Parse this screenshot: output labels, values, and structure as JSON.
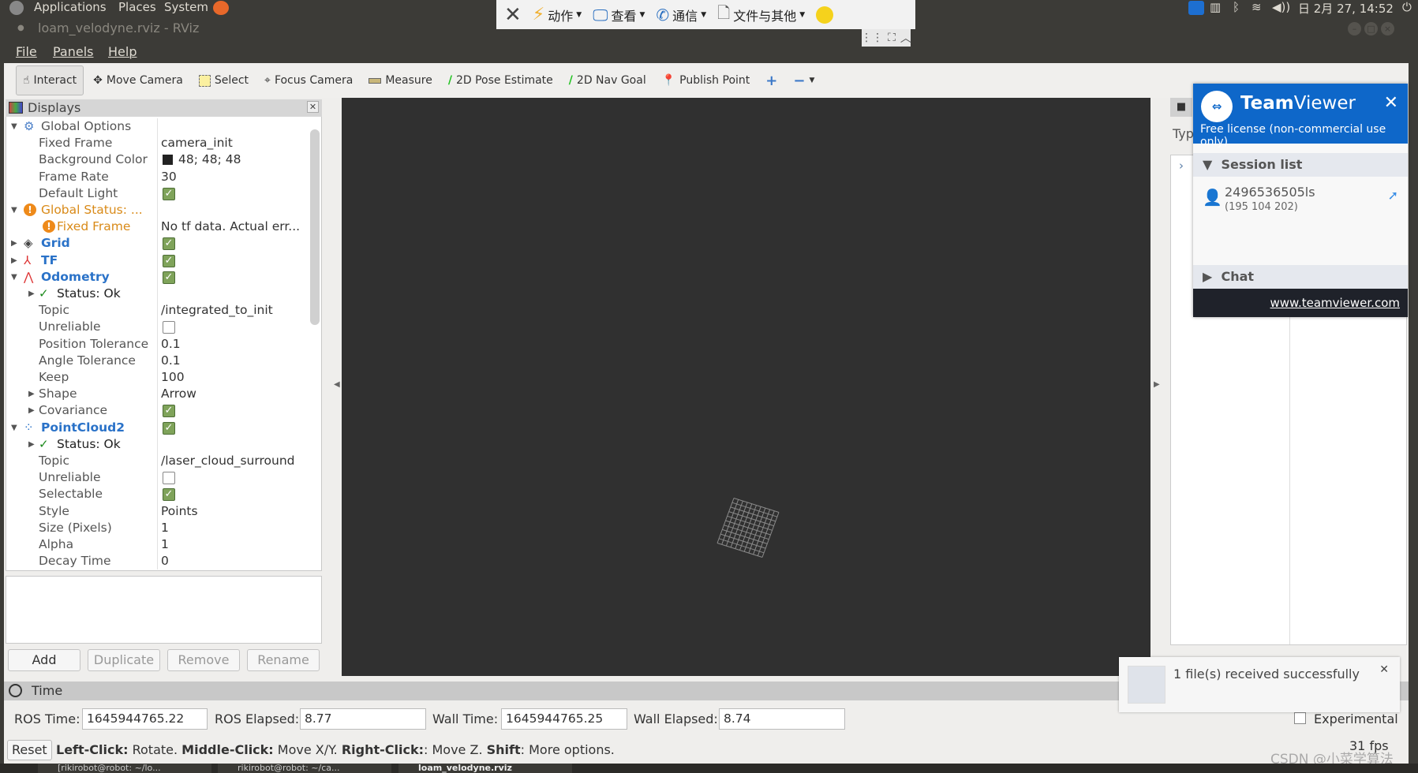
{
  "top_panel": {
    "menus": [
      "Applications",
      "Places",
      "System"
    ],
    "clock": "日 2月 27, 14:52"
  },
  "remote_toolbar": {
    "items": [
      "动作",
      "查看",
      "通信",
      "文件与其他"
    ]
  },
  "window": {
    "title": "loam_velodyne.rviz - RViz",
    "menus": [
      "File",
      "Panels",
      "Help"
    ]
  },
  "toolbar": {
    "tools": [
      "Interact",
      "Move Camera",
      "Select",
      "Focus Camera",
      "Measure",
      "2D Pose Estimate",
      "2D Nav Goal",
      "Publish Point"
    ]
  },
  "displays": {
    "title": "Displays",
    "rows": [
      {
        "label": "Global Options",
        "value": "",
        "indent": 1,
        "expand": "open",
        "icon": "gear-icon",
        "style": "normal"
      },
      {
        "label": "Fixed Frame",
        "value": "camera_init",
        "indent": 2
      },
      {
        "label": "Background Color",
        "value": "48; 48; 48",
        "indent": 2,
        "swatch": "#303030"
      },
      {
        "label": "Frame Rate",
        "value": "30",
        "indent": 2
      },
      {
        "label": "Default Light",
        "check": true,
        "indent": 2
      },
      {
        "label": "Global Status: ...",
        "value": "",
        "indent": 1,
        "expand": "open",
        "icon": "warning-icon",
        "style": "orange"
      },
      {
        "label": "Fixed Frame",
        "value": "No tf data.  Actual err...",
        "indent": 2,
        "icon": "warning-icon",
        "style": "orange"
      },
      {
        "label": "Grid",
        "check": true,
        "indent": 1,
        "expand": "closed",
        "icon": "grid-icon",
        "style": "blue"
      },
      {
        "label": "TF",
        "check": true,
        "indent": 1,
        "expand": "closed",
        "icon": "tf-axes-icon",
        "style": "blue"
      },
      {
        "label": "Odometry",
        "check": true,
        "indent": 1,
        "expand": "open",
        "icon": "odometry-icon",
        "style": "blue"
      },
      {
        "label": "Status: Ok",
        "indent": 2,
        "expand": "closed",
        "icon": "checkmark-icon",
        "style": "dark"
      },
      {
        "label": "Topic",
        "value": "/integrated_to_init",
        "indent": 2
      },
      {
        "label": "Unreliable",
        "check": false,
        "indent": 2
      },
      {
        "label": "Position Tolerance",
        "value": "0.1",
        "indent": 2
      },
      {
        "label": "Angle Tolerance",
        "value": "0.1",
        "indent": 2
      },
      {
        "label": "Keep",
        "value": "100",
        "indent": 2
      },
      {
        "label": "Shape",
        "value": "Arrow",
        "indent": 2,
        "expand": "closed"
      },
      {
        "label": "Covariance",
        "check": true,
        "indent": 2,
        "expand": "closed"
      },
      {
        "label": "PointCloud2",
        "check": true,
        "indent": 1,
        "expand": "open",
        "icon": "pointcloud-icon",
        "style": "blue"
      },
      {
        "label": "Status: Ok",
        "indent": 2,
        "expand": "closed",
        "icon": "checkmark-icon",
        "style": "dark"
      },
      {
        "label": "Topic",
        "value": "/laser_cloud_surround",
        "indent": 2
      },
      {
        "label": "Unreliable",
        "check": false,
        "indent": 2
      },
      {
        "label": "Selectable",
        "check": true,
        "indent": 2
      },
      {
        "label": "Style",
        "value": "Points",
        "indent": 2
      },
      {
        "label": "Size (Pixels)",
        "value": "1",
        "indent": 2
      },
      {
        "label": "Alpha",
        "value": "1",
        "indent": 2
      },
      {
        "label": "Decay Time",
        "value": "0",
        "indent": 2
      }
    ],
    "buttons": [
      "Add",
      "Duplicate",
      "Remove",
      "Rename"
    ]
  },
  "right_panel": {
    "type_label": "Typ"
  },
  "time": {
    "title": "Time",
    "ros_time_label": "ROS Time:",
    "ros_time": "1645944765.22",
    "ros_elapsed_label": "ROS Elapsed:",
    "ros_elapsed": "8.77",
    "wall_time_label": "Wall Time:",
    "wall_time": "1645944765.25",
    "wall_elapsed_label": "Wall Elapsed:",
    "wall_elapsed": "8.74",
    "experimental": "Experimental"
  },
  "status": {
    "reset": "Reset",
    "k1": "Left-Click:",
    "v1": " Rotate. ",
    "k2": "Middle-Click:",
    "v2": " Move X/Y. ",
    "k3": "Right-Click:",
    "v3": ": Move Z. ",
    "k4": "Shift",
    "v4": ": More options.",
    "fps": "31 fps"
  },
  "taskbar": {
    "items": [
      "[rikirobot@robot: ~/lo...",
      "rikirobot@robot: ~/ca...",
      "loam_velodyne.rviz"
    ]
  },
  "teamviewer": {
    "brand_bold": "Team",
    "brand_light": "Viewer",
    "license": "Free license (non-commercial use only)",
    "session_list": "Session list",
    "session_id": "2496536505ls",
    "session_sub": "(195 104 202)",
    "chat": "Chat",
    "link": "www.teamviewer.com",
    "color": "#0e67c9"
  },
  "notification": {
    "text": "1 file(s) received successfully"
  },
  "watermark": "CSDN @小菜学算法"
}
